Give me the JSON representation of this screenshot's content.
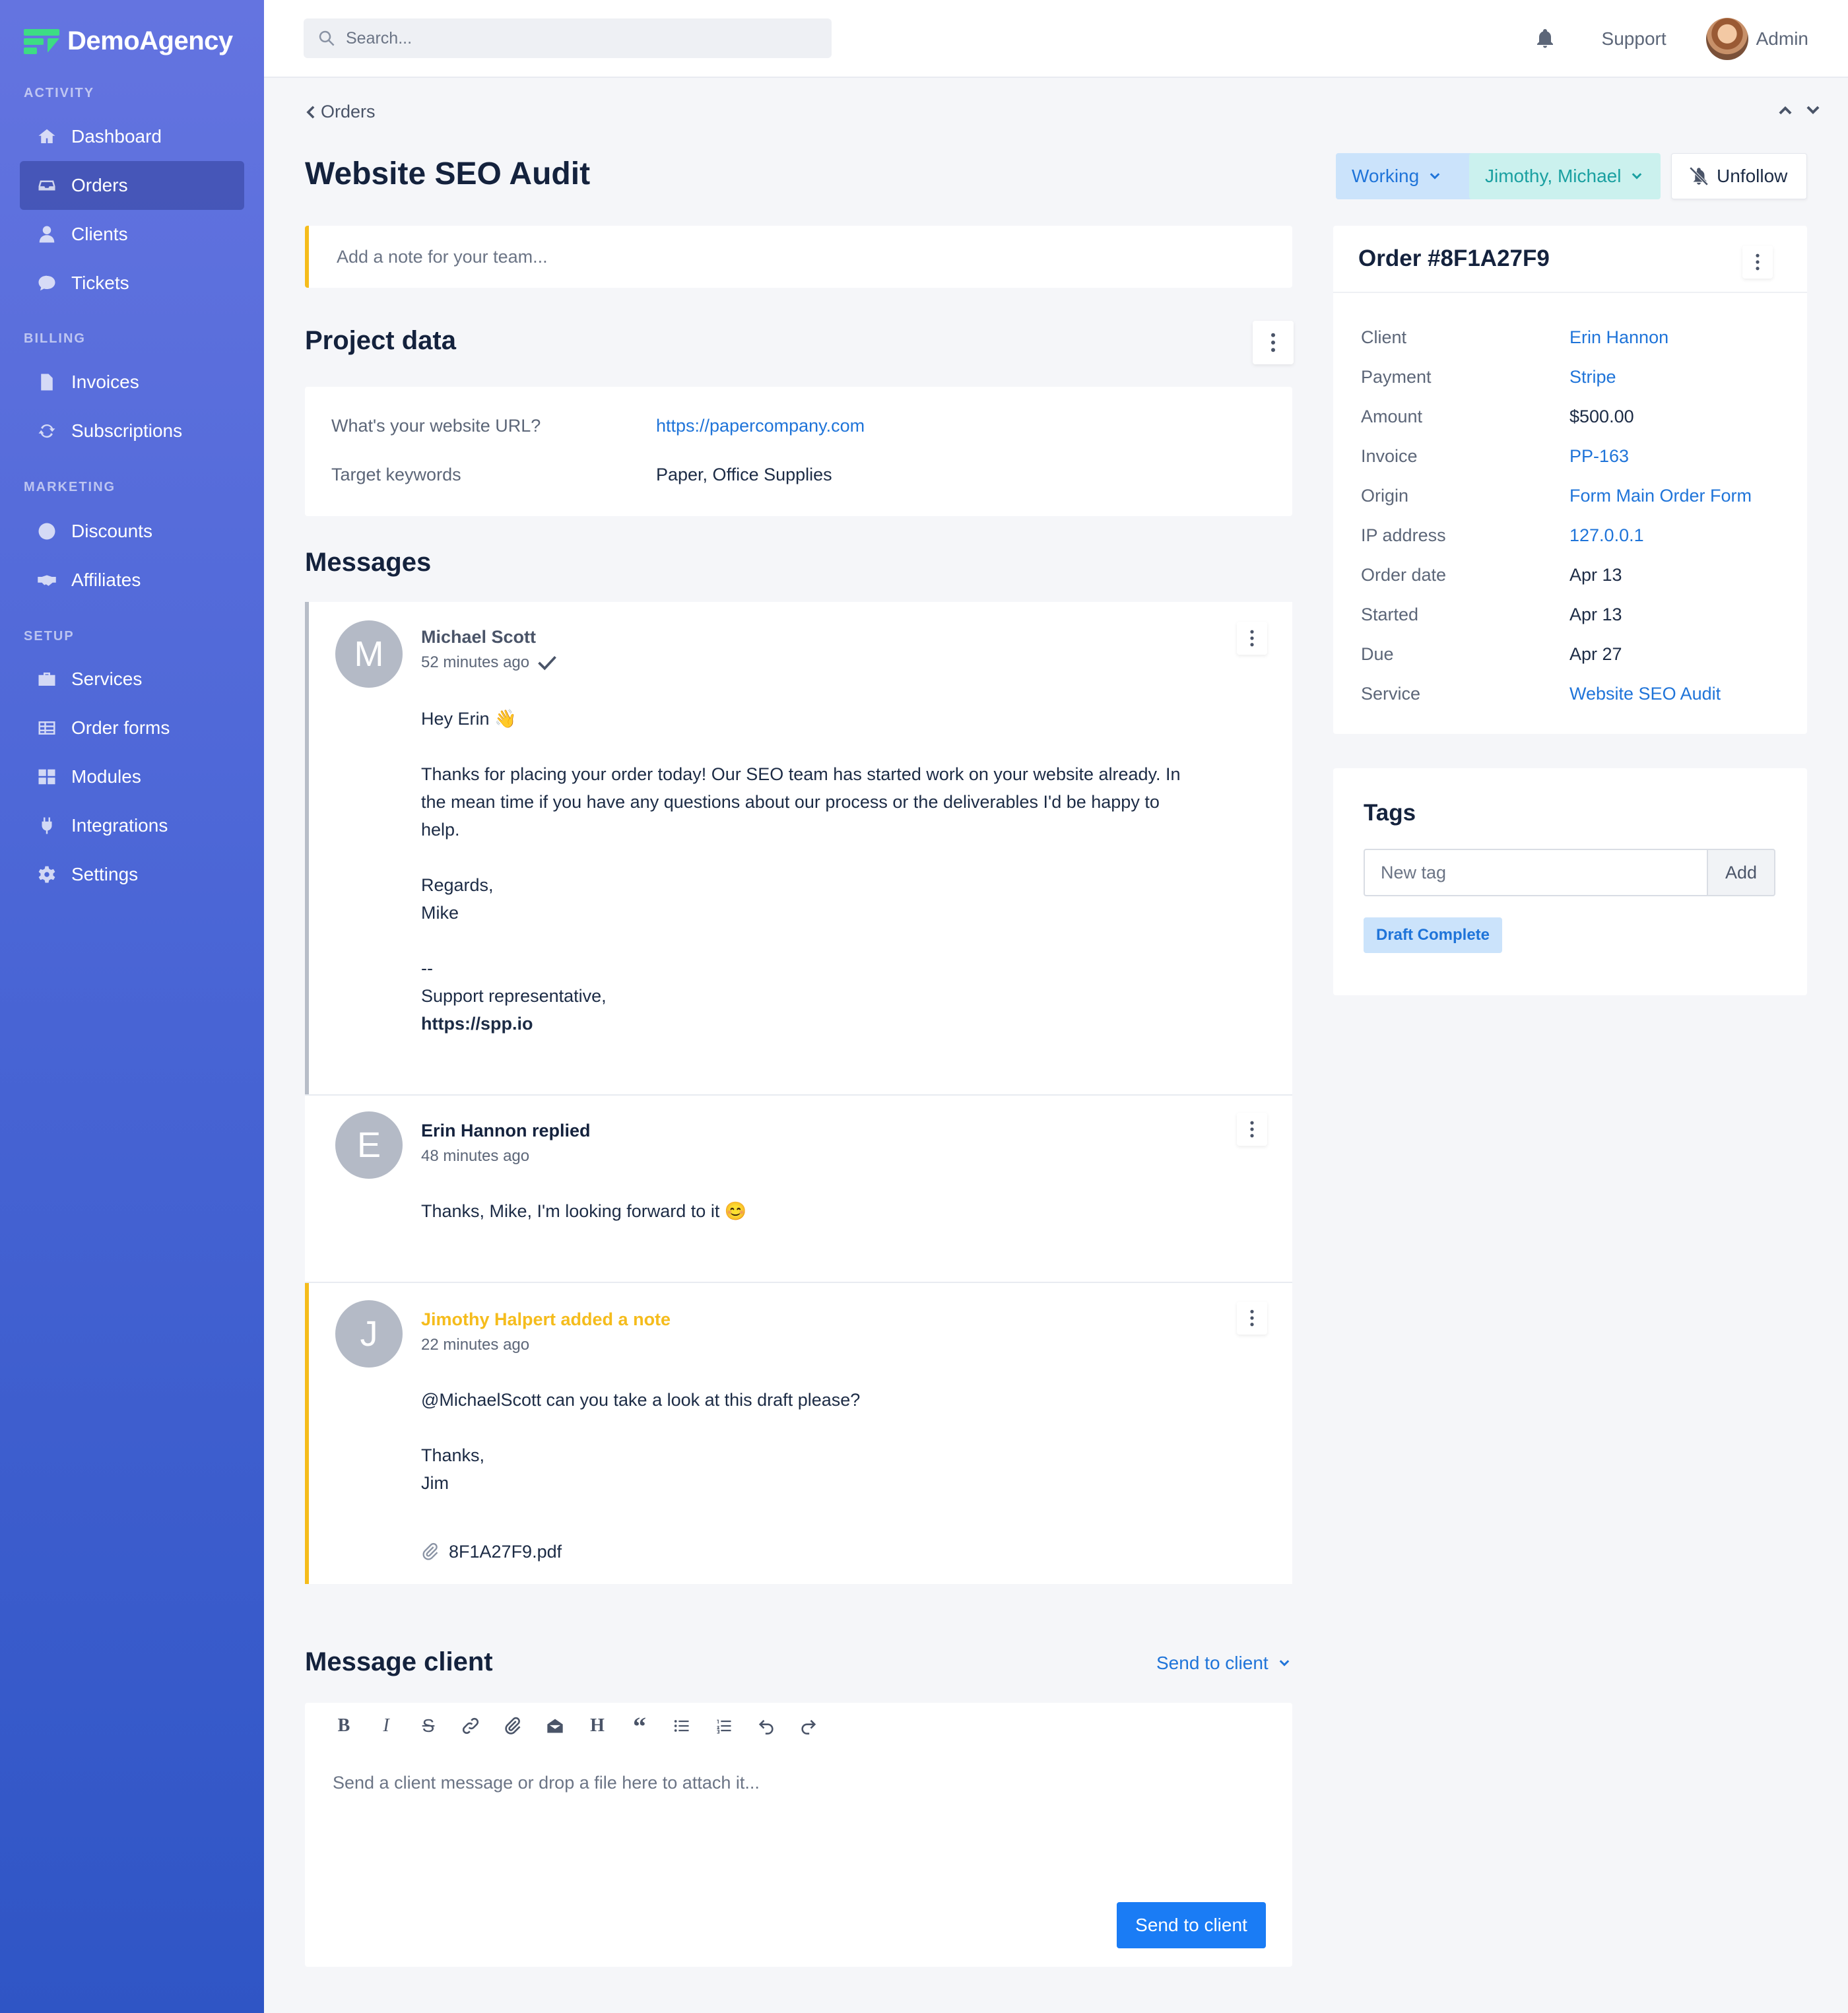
{
  "brand": {
    "name": "DemoAgency",
    "accent": "#3ddc84"
  },
  "sidebar": {
    "sections": [
      "ACTIVITY",
      "BILLING",
      "MARKETING",
      "SETUP"
    ],
    "items": [
      {
        "label": "Dashboard",
        "icon": "home-icon"
      },
      {
        "label": "Orders",
        "icon": "inbox-icon",
        "active": true
      },
      {
        "label": "Clients",
        "icon": "user-icon"
      },
      {
        "label": "Tickets",
        "icon": "chat-icon"
      },
      {
        "label": "Invoices",
        "icon": "file-icon"
      },
      {
        "label": "Subscriptions",
        "icon": "sync-icon"
      },
      {
        "label": "Discounts",
        "icon": "badge-percent-icon"
      },
      {
        "label": "Affiliates",
        "icon": "handshake-icon"
      },
      {
        "label": "Services",
        "icon": "briefcase-icon"
      },
      {
        "label": "Order forms",
        "icon": "table-icon"
      },
      {
        "label": "Modules",
        "icon": "grid-icon"
      },
      {
        "label": "Integrations",
        "icon": "plug-icon"
      },
      {
        "label": "Settings",
        "icon": "gear-icon"
      }
    ]
  },
  "topbar": {
    "search_placeholder": "Search...",
    "support": "Support",
    "user": "Admin"
  },
  "page": {
    "breadcrumb": "Orders",
    "title": "Website SEO Audit",
    "status": "Working",
    "assignees": "Jimothy, Michael",
    "follow": "Unfollow",
    "note_placeholder": "Add a note for your team..."
  },
  "project_data": {
    "title": "Project data",
    "rows": [
      {
        "label": "What's your website URL?",
        "value": "https://papercompany.com"
      },
      {
        "label": "Target keywords",
        "value": "Paper, Office Supplies"
      }
    ]
  },
  "messages": {
    "title": "Messages",
    "items": [
      {
        "initial": "M",
        "author": "Michael Scott",
        "time": "52 minutes ago",
        "body": "Hey Erin 👋\n\nThanks for placing your order today! Our SEO team has started work on your website already. In\nthe mean time if you have any questions about our process or the deliverables I'd be happy to\nhelp.\n\nRegards,\nMike\n\n--\nSupport representative,",
        "link": "https://spp.io"
      },
      {
        "initial": "E",
        "author": "Erin Hannon replied",
        "time": "48 minutes ago",
        "body": "Thanks, Mike, I'm looking forward to it 😊"
      },
      {
        "initial": "J",
        "author": "Jimothy Halpert added a note",
        "time": "22 minutes ago",
        "body": "@MichaelScott can you take a look at this draft please?\n\nThanks,\nJim",
        "attachment": "8F1A27F9.pdf"
      }
    ]
  },
  "composer": {
    "title": "Message client",
    "mode": "Send to client",
    "placeholder": "Send a client message or drop a file here to attach it...",
    "send": "Send to client"
  },
  "order": {
    "title": "Order #8F1A27F9",
    "fields": [
      {
        "label": "Client",
        "value": "Erin Hannon",
        "link": true
      },
      {
        "label": "Payment",
        "value": "Stripe",
        "link": true
      },
      {
        "label": "Amount",
        "value": "$500.00",
        "link": false
      },
      {
        "label": "Invoice",
        "value": "PP-163",
        "link": true
      },
      {
        "label": "Origin",
        "value": "Form Main Order Form",
        "link": true
      },
      {
        "label": "IP address",
        "value": "127.0.0.1",
        "link": true
      },
      {
        "label": "Order date",
        "value": "Apr 13",
        "link": false
      },
      {
        "label": "Started",
        "value": "Apr 13",
        "link": false
      },
      {
        "label": "Due",
        "value": "Apr 27",
        "link": false
      },
      {
        "label": "Service",
        "value": "Website SEO Audit",
        "link": true
      }
    ]
  },
  "tags": {
    "title": "Tags",
    "placeholder": "New tag",
    "add": "Add",
    "items": [
      "Draft Complete"
    ]
  }
}
